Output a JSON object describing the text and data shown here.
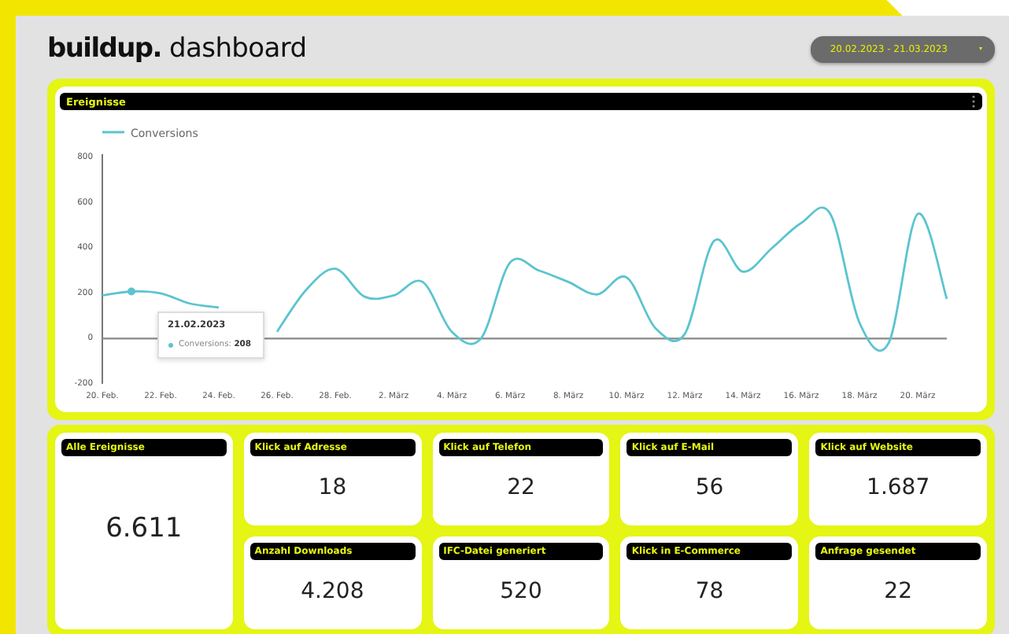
{
  "header": {
    "brand": "buildup.",
    "title": "dashboard",
    "date_range": "20.02.2023 - 21.03.2023"
  },
  "events_panel": {
    "title": "Ereignisse",
    "chart_data": {
      "type": "line",
      "categories": [
        "20. Feb.",
        null,
        "22. Feb.",
        null,
        "24. Feb.",
        null,
        "26. Feb.",
        null,
        "28. Feb.",
        null,
        "2. März",
        null,
        "4. März",
        null,
        "6. März",
        null,
        "8. März",
        null,
        "10. März",
        null,
        "12. März",
        null,
        "14. März",
        null,
        "16. März",
        null,
        "18. März",
        null,
        "20. März",
        null
      ],
      "series": [
        {
          "name": "Conversions",
          "color": "#5bc4cf",
          "values": [
            190,
            208,
            200,
            155,
            137,
            null,
            30,
            215,
            308,
            185,
            190,
            250,
            30,
            0,
            335,
            300,
            250,
            195,
            270,
            45,
            20,
            430,
            295,
            400,
            510,
            550,
            70,
            -20,
            550,
            175
          ]
        }
      ],
      "ylim": [
        -200,
        800
      ],
      "yticks": [
        -200,
        0,
        200,
        400,
        600,
        800
      ]
    },
    "tooltip": {
      "title": "21.02.2023",
      "text": "Conversions: **208**"
    }
  },
  "stats": [
    {
      "label": "Alle Ereignisse",
      "value": "6.611"
    },
    {
      "label": "Klick auf Adresse",
      "value": "18"
    },
    {
      "label": "Klick auf Telefon",
      "value": "22"
    },
    {
      "label": "Klick auf E-Mail",
      "value": "56"
    },
    {
      "label": "Klick auf Website",
      "value": "1.687"
    },
    {
      "label": "Anzahl Downloads",
      "value": "4.208"
    },
    {
      "label": "IFC-Datei generiert",
      "value": "520"
    },
    {
      "label": "Klick in E-Commerce",
      "value": "78"
    },
    {
      "label": "Anfrage gesendet",
      "value": "22"
    }
  ]
}
